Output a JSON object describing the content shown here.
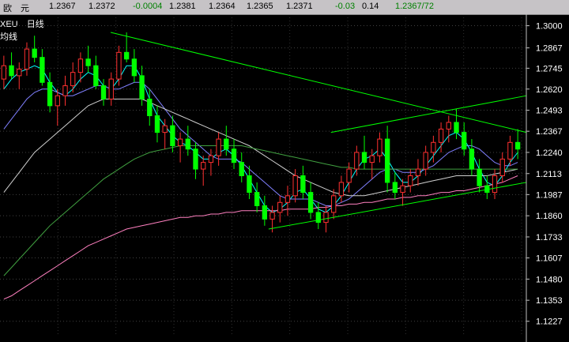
{
  "quote_bar": {
    "name": "欧　元",
    "open": "1.2367",
    "high": "1.2372",
    "change": "-0.0004",
    "bid": "1.2381",
    "low": "1.2364",
    "close": "1.2365",
    "last": "1.2371",
    "pct": "-0.03",
    "volume": "0.14",
    "quote": "1.2367/72"
  },
  "chart_label": {
    "symbol": "XEU",
    "period": "日线",
    "indicator": "均线"
  },
  "colors": {
    "up_candle": "#ff3030",
    "down_candle": "#54ffff",
    "body_down": "#00ff00",
    "trendline": "#00ff00",
    "ma_short": "#ffffff",
    "ma_cyan": "#00ffff",
    "ma_purple": "#8080ff",
    "ma_long": "#d0d0d0",
    "ma_green": "#40a040",
    "ma_pink": "#ff80c0"
  },
  "chart_data": {
    "type": "candlestick",
    "yticks": [
      "1.3000",
      "1.2867",
      "1.2745",
      "1.2620",
      "1.2493",
      "1.2367",
      "1.2240",
      "1.2113",
      "1.1987",
      "1.1860",
      "1.1733",
      "1.1607",
      "1.1480",
      "1.1353",
      "1.1227"
    ],
    "ylim": [
      1.115,
      1.305
    ],
    "grid": true,
    "candles": [
      [
        1.268,
        1.282,
        1.262,
        1.276
      ],
      [
        1.276,
        1.284,
        1.268,
        1.27
      ],
      [
        1.27,
        1.278,
        1.262,
        1.274
      ],
      [
        1.274,
        1.29,
        1.27,
        1.286
      ],
      [
        1.286,
        1.294,
        1.278,
        1.281
      ],
      [
        1.281,
        1.286,
        1.264,
        1.266
      ],
      [
        1.266,
        1.272,
        1.248,
        1.252
      ],
      [
        1.252,
        1.262,
        1.24,
        1.258
      ],
      [
        1.258,
        1.27,
        1.252,
        1.264
      ],
      [
        1.264,
        1.278,
        1.26,
        1.272
      ],
      [
        1.272,
        1.284,
        1.266,
        1.28
      ],
      [
        1.28,
        1.288,
        1.272,
        1.276
      ],
      [
        1.276,
        1.282,
        1.262,
        1.264
      ],
      [
        1.264,
        1.268,
        1.252,
        1.256
      ],
      [
        1.256,
        1.272,
        1.252,
        1.268
      ],
      [
        1.268,
        1.288,
        1.264,
        1.284
      ],
      [
        1.284,
        1.296,
        1.278,
        1.28
      ],
      [
        1.28,
        1.286,
        1.266,
        1.27
      ],
      [
        1.27,
        1.276,
        1.252,
        1.256
      ],
      [
        1.256,
        1.262,
        1.24,
        1.246
      ],
      [
        1.246,
        1.252,
        1.23,
        1.236
      ],
      [
        1.236,
        1.244,
        1.226,
        1.24
      ],
      [
        1.24,
        1.246,
        1.224,
        1.228
      ],
      [
        1.228,
        1.236,
        1.218,
        1.232
      ],
      [
        1.232,
        1.24,
        1.222,
        1.226
      ],
      [
        1.226,
        1.23,
        1.208,
        1.214
      ],
      [
        1.214,
        1.222,
        1.204,
        1.218
      ],
      [
        1.218,
        1.226,
        1.21,
        1.222
      ],
      [
        1.222,
        1.236,
        1.216,
        1.232
      ],
      [
        1.232,
        1.24,
        1.222,
        1.226
      ],
      [
        1.226,
        1.232,
        1.214,
        1.218
      ],
      [
        1.218,
        1.224,
        1.206,
        1.21
      ],
      [
        1.21,
        1.216,
        1.196,
        1.2
      ],
      [
        1.2,
        1.206,
        1.188,
        1.192
      ],
      [
        1.192,
        1.198,
        1.18,
        1.184
      ],
      [
        1.184,
        1.192,
        1.176,
        1.188
      ],
      [
        1.188,
        1.198,
        1.182,
        1.194
      ],
      [
        1.194,
        1.204,
        1.186,
        1.198
      ],
      [
        1.198,
        1.214,
        1.194,
        1.21
      ],
      [
        1.21,
        1.216,
        1.196,
        1.2
      ],
      [
        1.2,
        1.206,
        1.184,
        1.188
      ],
      [
        1.188,
        1.194,
        1.178,
        1.182
      ],
      [
        1.182,
        1.192,
        1.176,
        1.188
      ],
      [
        1.188,
        1.202,
        1.184,
        1.198
      ],
      [
        1.198,
        1.21,
        1.194,
        1.206
      ],
      [
        1.206,
        1.218,
        1.2,
        1.214
      ],
      [
        1.214,
        1.228,
        1.21,
        1.224
      ],
      [
        1.224,
        1.234,
        1.214,
        1.218
      ],
      [
        1.218,
        1.226,
        1.208,
        1.222
      ],
      [
        1.222,
        1.236,
        1.218,
        1.232
      ],
      [
        1.232,
        1.24,
        1.2,
        1.206
      ],
      [
        1.206,
        1.212,
        1.196,
        1.2
      ],
      [
        1.2,
        1.208,
        1.192,
        1.204
      ],
      [
        1.204,
        1.214,
        1.2,
        1.21
      ],
      [
        1.21,
        1.22,
        1.204,
        1.214
      ],
      [
        1.214,
        1.228,
        1.21,
        1.224
      ],
      [
        1.224,
        1.234,
        1.218,
        1.23
      ],
      [
        1.23,
        1.242,
        1.224,
        1.238
      ],
      [
        1.238,
        1.246,
        1.23,
        1.242
      ],
      [
        1.242,
        1.25,
        1.232,
        1.236
      ],
      [
        1.236,
        1.242,
        1.222,
        1.226
      ],
      [
        1.226,
        1.232,
        1.21,
        1.214
      ],
      [
        1.214,
        1.22,
        1.2,
        1.204
      ],
      [
        1.204,
        1.21,
        1.196,
        1.2
      ],
      [
        1.2,
        1.214,
        1.196,
        1.21
      ],
      [
        1.21,
        1.224,
        1.206,
        1.22
      ],
      [
        1.22,
        1.234,
        1.216,
        1.23
      ],
      [
        1.23,
        1.238,
        1.22,
        1.226
      ]
    ],
    "trendlines": [
      [
        [
          0.0,
          1.296
        ],
        [
          1.0,
          1.236
        ]
      ],
      [
        [
          0.53,
          1.236
        ],
        [
          1.0,
          1.258
        ]
      ],
      [
        [
          0.38,
          1.178
        ],
        [
          1.0,
          1.206
        ]
      ]
    ],
    "moving_averages": [
      {
        "color_key": "ma_cyan",
        "values": [
          1.262,
          1.268,
          1.272,
          1.274,
          1.276,
          1.274,
          1.266,
          1.26,
          1.258,
          1.262,
          1.268,
          1.272,
          1.27,
          1.264,
          1.262,
          1.268,
          1.276,
          1.276,
          1.268,
          1.256,
          1.246,
          1.24,
          1.234,
          1.23,
          1.228,
          1.224,
          1.22,
          1.22,
          1.224,
          1.226,
          1.222,
          1.216,
          1.208,
          1.2,
          1.192,
          1.188,
          1.19,
          1.194,
          1.2,
          1.202,
          1.196,
          1.19,
          1.188,
          1.192,
          1.198,
          1.206,
          1.214,
          1.22,
          1.222,
          1.226,
          1.22,
          1.212,
          1.206,
          1.206,
          1.21,
          1.216,
          1.222,
          1.228,
          1.234,
          1.236,
          1.232,
          1.224,
          1.214,
          1.206,
          1.204,
          1.21,
          1.218,
          1.224
        ]
      },
      {
        "color_key": "ma_purple",
        "values": [
          1.238,
          1.244,
          1.25,
          1.256,
          1.26,
          1.262,
          1.262,
          1.26,
          1.258,
          1.258,
          1.26,
          1.262,
          1.264,
          1.264,
          1.262,
          1.262,
          1.264,
          1.266,
          1.266,
          1.262,
          1.256,
          1.25,
          1.244,
          1.238,
          1.234,
          1.23,
          1.226,
          1.222,
          1.22,
          1.22,
          1.22,
          1.218,
          1.214,
          1.21,
          1.206,
          1.202,
          1.198,
          1.196,
          1.196,
          1.196,
          1.196,
          1.194,
          1.192,
          1.192,
          1.194,
          1.196,
          1.2,
          1.204,
          1.208,
          1.212,
          1.214,
          1.214,
          1.212,
          1.212,
          1.212,
          1.214,
          1.216,
          1.22,
          1.224,
          1.226,
          1.228,
          1.228,
          1.226,
          1.222,
          1.218,
          1.216,
          1.216,
          1.218
        ]
      },
      {
        "color_key": "ma_long",
        "values": [
          1.2,
          1.206,
          1.212,
          1.218,
          1.224,
          1.228,
          1.232,
          1.236,
          1.24,
          1.244,
          1.248,
          1.252,
          1.254,
          1.256,
          1.256,
          1.256,
          1.256,
          1.256,
          1.256,
          1.254,
          1.252,
          1.25,
          1.248,
          1.246,
          1.244,
          1.242,
          1.24,
          1.238,
          1.236,
          1.234,
          1.232,
          1.23,
          1.228,
          1.225,
          1.222,
          1.219,
          1.216,
          1.213,
          1.21,
          1.208,
          1.206,
          1.204,
          1.202,
          1.2,
          1.199,
          1.198,
          1.198,
          1.198,
          1.199,
          1.2,
          1.201,
          1.202,
          1.203,
          1.204,
          1.205,
          1.206,
          1.207,
          1.208,
          1.209,
          1.21,
          1.21,
          1.21,
          1.21,
          1.21,
          1.211,
          1.212,
          1.213,
          1.214
        ]
      },
      {
        "color_key": "ma_green",
        "values": [
          1.15,
          1.155,
          1.16,
          1.165,
          1.17,
          1.175,
          1.18,
          1.184,
          1.188,
          1.192,
          1.196,
          1.2,
          1.204,
          1.208,
          1.211,
          1.214,
          1.217,
          1.22,
          1.222,
          1.224,
          1.225,
          1.226,
          1.227,
          1.228,
          1.228,
          1.228,
          1.228,
          1.228,
          1.228,
          1.228,
          1.228,
          1.228,
          1.227,
          1.226,
          1.225,
          1.224,
          1.223,
          1.222,
          1.221,
          1.22,
          1.219,
          1.218,
          1.217,
          1.216,
          1.215,
          1.215,
          1.214,
          1.214,
          1.214,
          1.214,
          1.214,
          1.214,
          1.214,
          1.214,
          1.214,
          1.214,
          1.214,
          1.214,
          1.214,
          1.214,
          1.214,
          1.214,
          1.214,
          1.214,
          1.214,
          1.214,
          1.214,
          1.214
        ]
      },
      {
        "color_key": "ma_pink",
        "values": [
          1.136,
          1.138,
          1.141,
          1.144,
          1.147,
          1.15,
          1.153,
          1.156,
          1.159,
          1.162,
          1.165,
          1.168,
          1.17,
          1.172,
          1.174,
          1.176,
          1.178,
          1.179,
          1.18,
          1.181,
          1.182,
          1.183,
          1.184,
          1.185,
          1.185,
          1.186,
          1.186,
          1.187,
          1.187,
          1.188,
          1.188,
          1.189,
          1.189,
          1.189,
          1.189,
          1.189,
          1.189,
          1.19,
          1.19,
          1.19,
          1.19,
          1.191,
          1.191,
          1.192,
          1.192,
          1.193,
          1.193,
          1.194,
          1.194,
          1.195,
          1.196,
          1.196,
          1.197,
          1.197,
          1.198,
          1.198,
          1.199,
          1.2,
          1.2,
          1.201,
          1.201,
          1.202,
          1.203,
          1.204,
          1.205,
          1.206,
          1.208,
          1.21
        ]
      }
    ]
  }
}
